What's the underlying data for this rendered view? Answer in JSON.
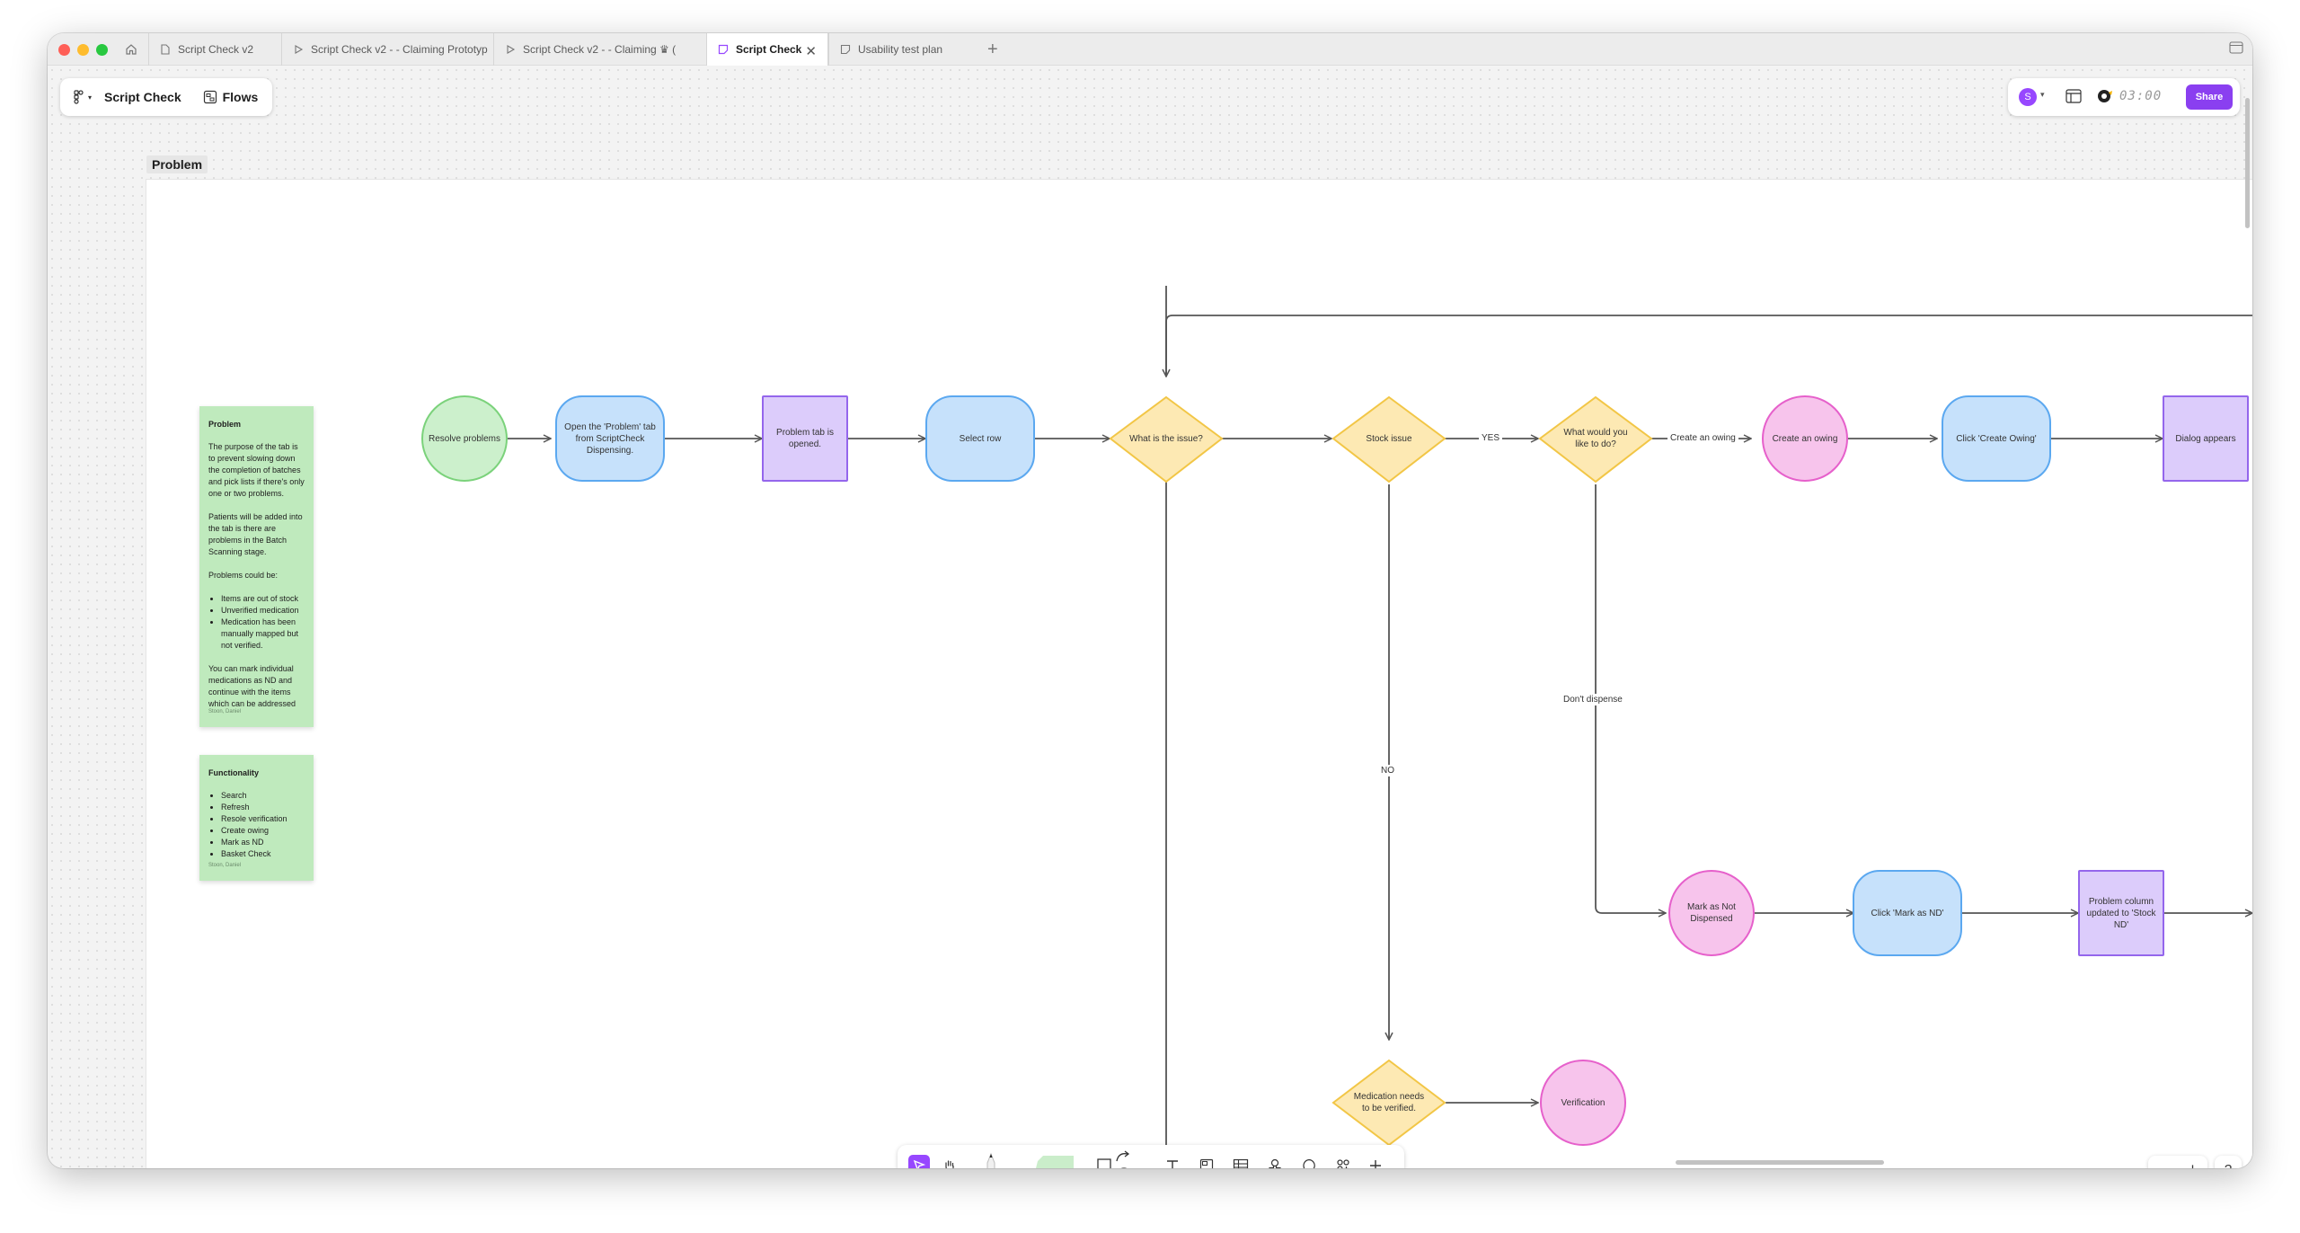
{
  "tabs": [
    {
      "label": "Script Check v2",
      "icon": "file-icon"
    },
    {
      "label": "Script Check v2 - - Claiming Prototyp",
      "icon": "play-icon"
    },
    {
      "label": "Script Check v2 - - Claiming ♛ (",
      "icon": "play-icon"
    },
    {
      "label": "Script Check",
      "icon": "figjam-file-icon",
      "active": true
    },
    {
      "label": "Usability test plan",
      "icon": "figjam-file-icon"
    }
  ],
  "toolbar": {
    "file_name": "Script Check",
    "flows_label": "Flows",
    "avatar_initial": "S",
    "timer": "03:00",
    "share_label": "Share"
  },
  "frame_label": "Problem",
  "sticky_problem": {
    "title": "Problem",
    "p1": "The purpose of the tab is to prevent slowing down the completion of batches and pick lists if there's only one or two problems.",
    "p2": "Patients will be added into the tab is there are problems in the Batch Scanning stage.",
    "p3": "Problems could be:",
    "items": [
      "Items are out of stock",
      "Unverified medication",
      "Medication has been manually mapped but not verified."
    ],
    "p4": "You can mark individual medications as ND and continue with the items which can be addressed",
    "author": "Stoon, Daniel"
  },
  "sticky_functionality": {
    "title": "Functionality",
    "items": [
      "Search",
      "Refresh",
      "Resole verification",
      "Create owing",
      "Mark as ND",
      "Basket Check"
    ],
    "author": "Stoon, Daniel"
  },
  "nodes": {
    "resolve": "Resolve problems",
    "open_tab": "Open the 'Problem' tab from ScriptCheck Dispensing.",
    "tab_opened": "Problem tab is opened.",
    "select_row": "Select row",
    "what_issue": "What is the issue?",
    "stock_issue": "Stock issue",
    "what_do": "What would you like to do?",
    "create_owing": "Create an owing",
    "click_create_owing": "Click 'Create Owing'",
    "dialog": "Dialog appears",
    "mark_nd": "Mark as Not Dispensed",
    "click_mark_nd": "Click 'Mark as ND'",
    "column_updated": "Problem column updated to 'Stock ND'",
    "med_verify": "Medication needs to be verified.",
    "verification": "Verification"
  },
  "edge_labels": {
    "yes": "YES",
    "create_owing": "Create an owing",
    "dont_dispense": "Don't dispense",
    "no": "NO"
  },
  "colors": {
    "accent": "#9747ff",
    "share": "#8a3ff0",
    "sticky": "#bfeabd",
    "diamond_fill": "#fde9b3",
    "diamond_stroke": "#f2c646"
  }
}
